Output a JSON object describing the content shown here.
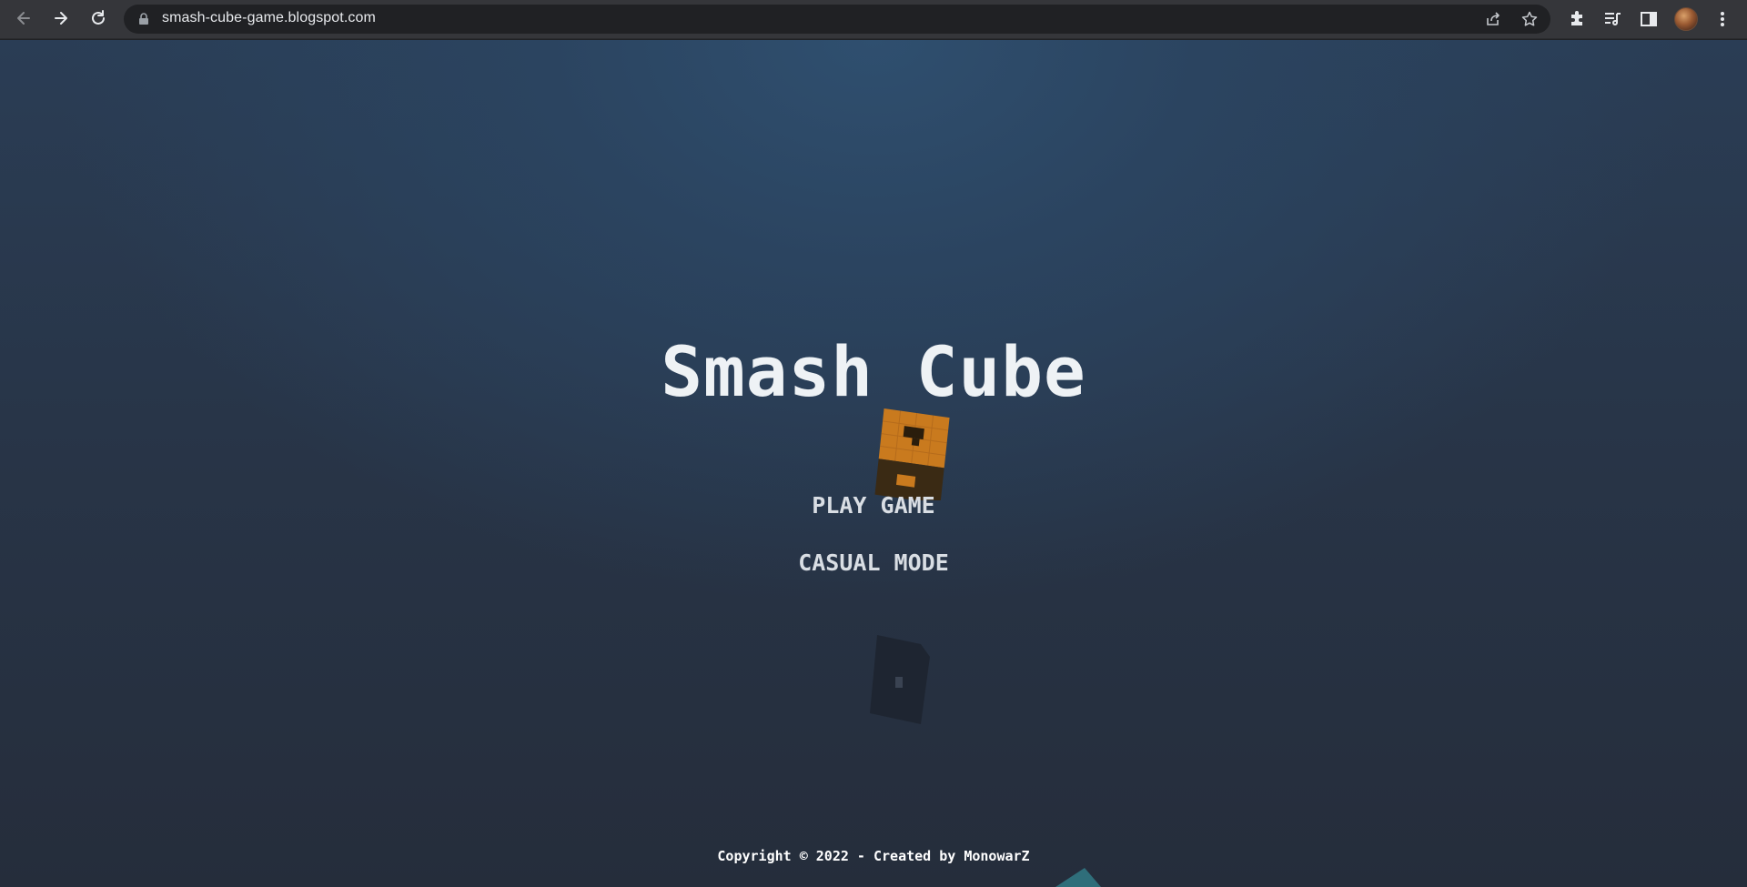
{
  "browser": {
    "url": "smash-cube-game.blogspot.com",
    "icons": [
      "back-icon",
      "forward-icon",
      "reload-icon",
      "lock-icon",
      "share-icon",
      "star-icon",
      "extensions-icon",
      "media-icon",
      "side-panel-icon",
      "avatar",
      "menu-icon"
    ]
  },
  "game": {
    "title": "Smash Cube",
    "menu": {
      "play": "PLAY GAME",
      "casual": "CASUAL MODE"
    },
    "footer": "Copyright © 2022 - Created by MonowarZ"
  },
  "colors": {
    "background_top": "#2f4f6f",
    "background_bottom": "#252d3b",
    "title": "#eef2f5",
    "menu_text": "#d9dee4",
    "cube_orange": "#c97a1e",
    "cube_dark": "#3a2a14",
    "shadow_cube": "#1e2530",
    "teal_cube": "#2f6e7a"
  }
}
